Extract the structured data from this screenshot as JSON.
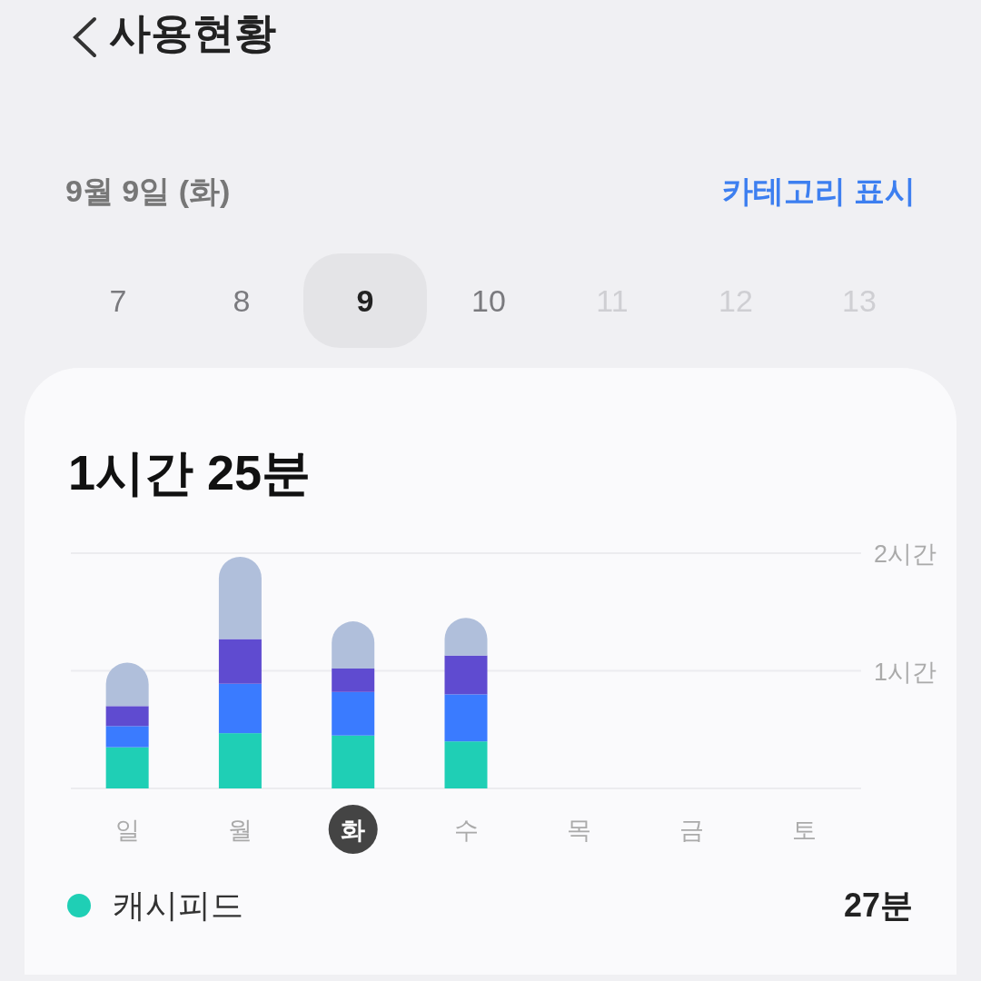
{
  "header": {
    "title": "사용현황"
  },
  "date_row": {
    "date": "9월 9일 (화)",
    "category_toggle": "카테고리 표시"
  },
  "day_picker": [
    {
      "label": "7",
      "selected": false,
      "disabled": false
    },
    {
      "label": "8",
      "selected": false,
      "disabled": false
    },
    {
      "label": "9",
      "selected": true,
      "disabled": false
    },
    {
      "label": "10",
      "selected": false,
      "disabled": false
    },
    {
      "label": "11",
      "selected": false,
      "disabled": true
    },
    {
      "label": "12",
      "selected": false,
      "disabled": true
    },
    {
      "label": "13",
      "selected": false,
      "disabled": true
    }
  ],
  "summary": {
    "total": "1시간 25분",
    "chart_data": {
      "type": "bar",
      "stacked": true,
      "categories": [
        "일",
        "월",
        "화",
        "수",
        "목",
        "금",
        "토"
      ],
      "ylim": [
        0,
        2
      ],
      "yticks": [
        {
          "value": 1,
          "label": "1시간"
        },
        {
          "value": 2,
          "label": "2시간"
        }
      ],
      "series": [
        {
          "color": "#1fcfb5",
          "values": [
            0.35,
            0.47,
            0.45,
            0.4,
            null,
            null,
            null
          ]
        },
        {
          "color": "#3a7bff",
          "values": [
            0.18,
            0.42,
            0.37,
            0.4,
            null,
            null,
            null
          ]
        },
        {
          "color": "#5f4bd0",
          "values": [
            0.17,
            0.38,
            0.2,
            0.33,
            null,
            null,
            null
          ]
        },
        {
          "color": "#b0bfdb",
          "values": [
            0.37,
            0.7,
            0.4,
            0.32,
            null,
            null,
            null
          ]
        }
      ]
    },
    "weekdays": [
      {
        "selected": false
      },
      {
        "selected": false
      },
      {
        "selected": true
      },
      {
        "selected": false
      },
      {
        "selected": false
      },
      {
        "selected": false
      },
      {
        "selected": false
      }
    ]
  },
  "legend": [
    {
      "name": "캐시피드",
      "color": "#1fcfb5",
      "value": "27분"
    }
  ]
}
